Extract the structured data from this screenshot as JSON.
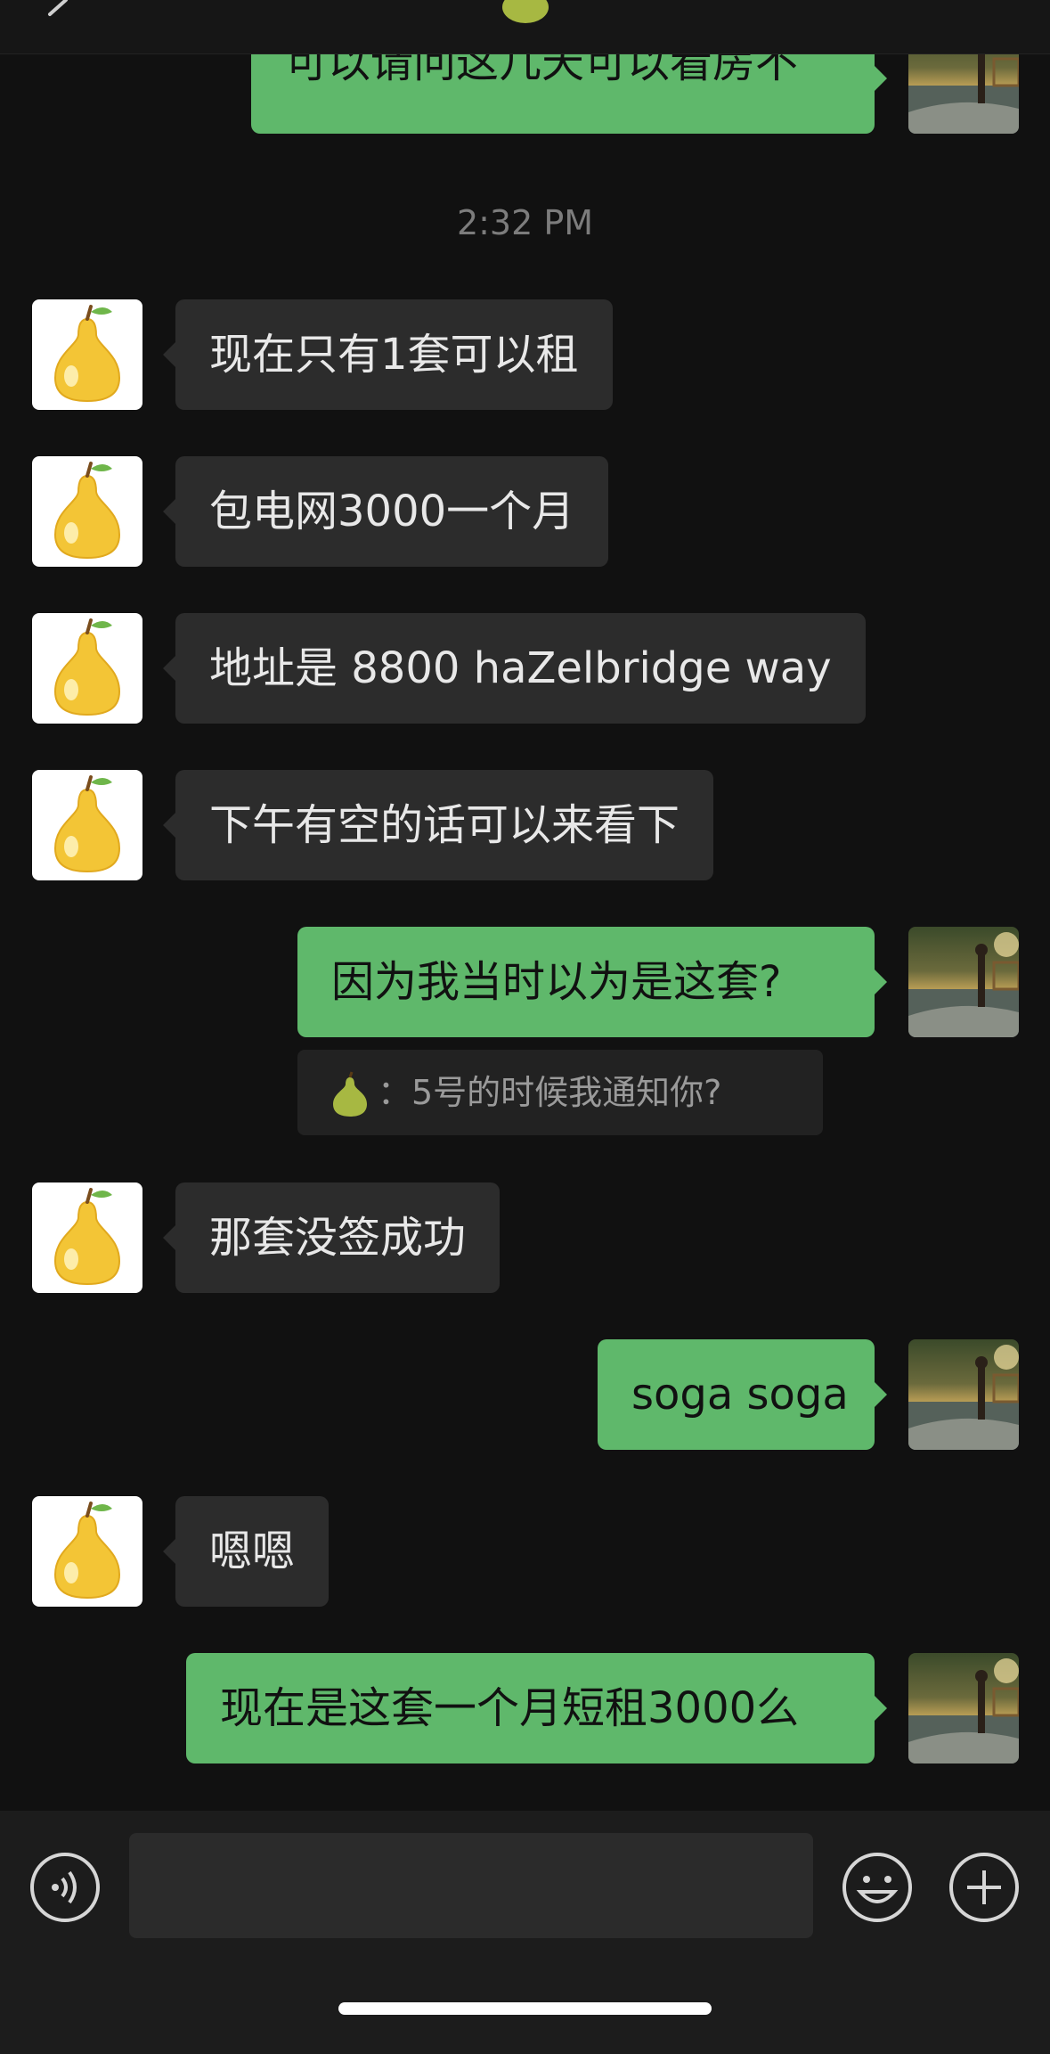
{
  "app": {
    "header_icon": "pear-icon"
  },
  "colors": {
    "background": "#111111",
    "incoming_bubble": "#2c2c2c",
    "outgoing_bubble": "#5fb86b",
    "timestamp": "#7c7c7c"
  },
  "messages": [
    {
      "direction": "out",
      "text": "可以请问这几天可以看房不"
    },
    {
      "direction": "time",
      "text": "2:32 PM"
    },
    {
      "direction": "in",
      "text": "现在只有1套可以租"
    },
    {
      "direction": "in",
      "text": "包电网3000一个月"
    },
    {
      "direction": "in",
      "text": "地址是 8800 haZelbridge way"
    },
    {
      "direction": "in",
      "text": "下午有空的话可以来看下"
    },
    {
      "direction": "out",
      "text": "因为我当时以为是这套?"
    },
    {
      "direction": "quote",
      "text": "：5号的时候我通知你?",
      "icon": "pear-icon"
    },
    {
      "direction": "in",
      "text": "那套没签成功"
    },
    {
      "direction": "out",
      "text": "soga soga"
    },
    {
      "direction": "in",
      "text": "嗯嗯"
    },
    {
      "direction": "out",
      "text": "现在是这套一个月短租3000么"
    }
  ],
  "input_bar": {
    "voice_icon": "voice-icon",
    "input_value": "",
    "emoji_icon": "emoji-icon",
    "plus_icon": "plus-icon"
  }
}
